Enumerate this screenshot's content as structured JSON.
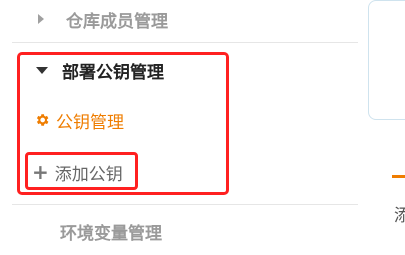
{
  "sidebar": {
    "items": [
      {
        "label": "仓库成员管理",
        "state": "collapsed"
      },
      {
        "label": "部署公钥管理",
        "state": "expanded",
        "children": [
          {
            "label": "公钥管理",
            "icon": "gear-icon",
            "active": true
          },
          {
            "label": "添加公钥",
            "icon": "plus-icon"
          }
        ]
      },
      {
        "label": "环境变量管理",
        "state": "collapsed"
      }
    ]
  },
  "right_panel": {
    "partial_text": "添"
  },
  "colors": {
    "accent": "#ef7d00",
    "highlight_border": "#ff2020"
  }
}
